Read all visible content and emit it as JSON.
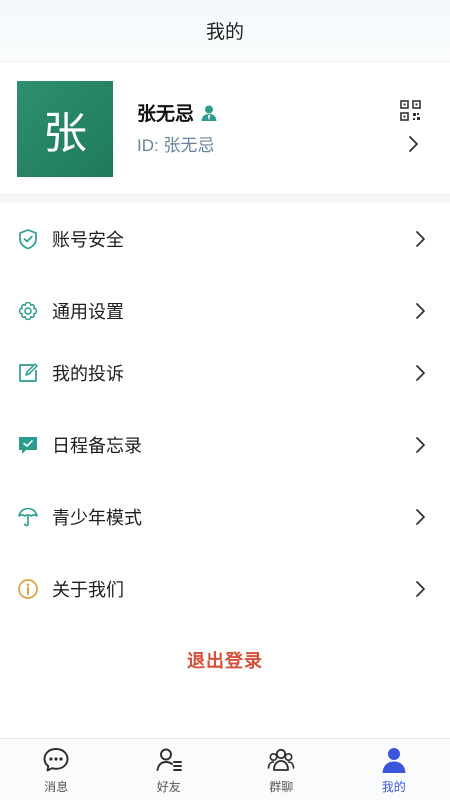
{
  "header": {
    "title": "我的"
  },
  "profile": {
    "avatar_char": "张",
    "name": "张无忌",
    "id_text": "ID: 张无忌",
    "badge_icon": "verified-user-icon",
    "qr_icon": "qr-code-icon"
  },
  "menu": {
    "items": [
      {
        "label": "账号安全",
        "icon": "shield-check-icon"
      },
      {
        "label": "通用设置",
        "icon": "gear-icon"
      },
      {
        "label": "我的投诉",
        "icon": "edit-square-icon"
      },
      {
        "label": "日程备忘录",
        "icon": "chat-memo-icon"
      },
      {
        "label": "青少年模式",
        "icon": "umbrella-icon"
      },
      {
        "label": "关于我们",
        "icon": "info-circle-icon"
      }
    ]
  },
  "logout": {
    "label": "退出登录"
  },
  "tabbar": {
    "tabs": [
      {
        "label": "消息",
        "icon": "message-icon",
        "active": false
      },
      {
        "label": "好友",
        "icon": "contacts-icon",
        "active": false
      },
      {
        "label": "群聊",
        "icon": "group-icon",
        "active": false
      },
      {
        "label": "我的",
        "icon": "profile-icon",
        "active": true
      }
    ]
  },
  "colors": {
    "accent_green": "#1f7a5c",
    "icon_teal": "#2a9d8f",
    "logout_red": "#d64f3b",
    "active_tab": "#3b55d8",
    "info_orange": "#d9a441"
  }
}
